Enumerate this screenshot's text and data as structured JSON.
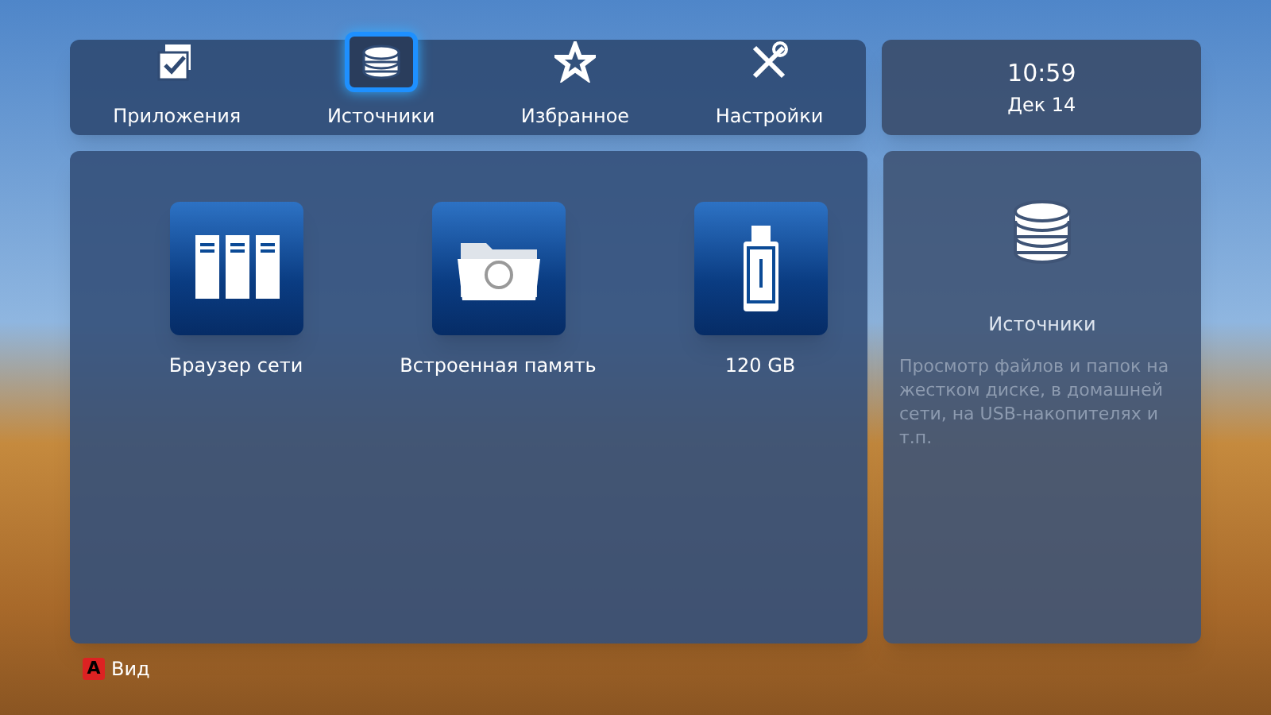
{
  "nav_tabs": [
    {
      "kind": "apps",
      "label": "Приложения",
      "selected": false
    },
    {
      "kind": "sources",
      "label": "Источники",
      "selected": true
    },
    {
      "kind": "favorites",
      "label": "Избранное",
      "selected": false
    },
    {
      "kind": "settings",
      "label": "Настройки",
      "selected": false
    }
  ],
  "clock": {
    "time": "10:59",
    "date": "Дек 14"
  },
  "devices": [
    {
      "kind": "network",
      "label": "Браузер сети"
    },
    {
      "kind": "internal",
      "label": "Встроенная память"
    },
    {
      "kind": "usb",
      "label": "120 GB"
    }
  ],
  "info_panel": {
    "title": "Источники",
    "description": "Просмотр файлов и папок на жестком диске, в домашней сети, на USB-накопителях и т.п."
  },
  "footer": {
    "key": "A",
    "label": "Вид"
  }
}
